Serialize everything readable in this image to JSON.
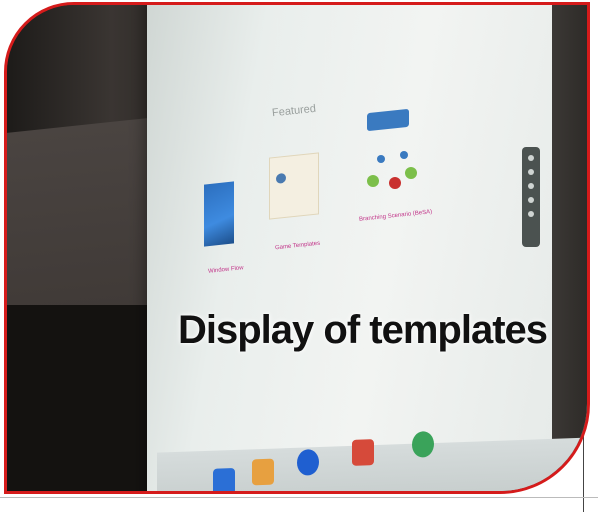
{
  "caption": "Display of templates",
  "screen": {
    "section_heading": "Featured",
    "cards": [
      {
        "title": "Window Flow",
        "description": ""
      },
      {
        "title": "Game Templates",
        "description": ""
      },
      {
        "title": "Branching Scenario (BeSA)",
        "description": ""
      }
    ]
  },
  "colors": {
    "frame_border": "#d51b1b",
    "caption_text": "#111111",
    "card_title": "#c2368a"
  }
}
